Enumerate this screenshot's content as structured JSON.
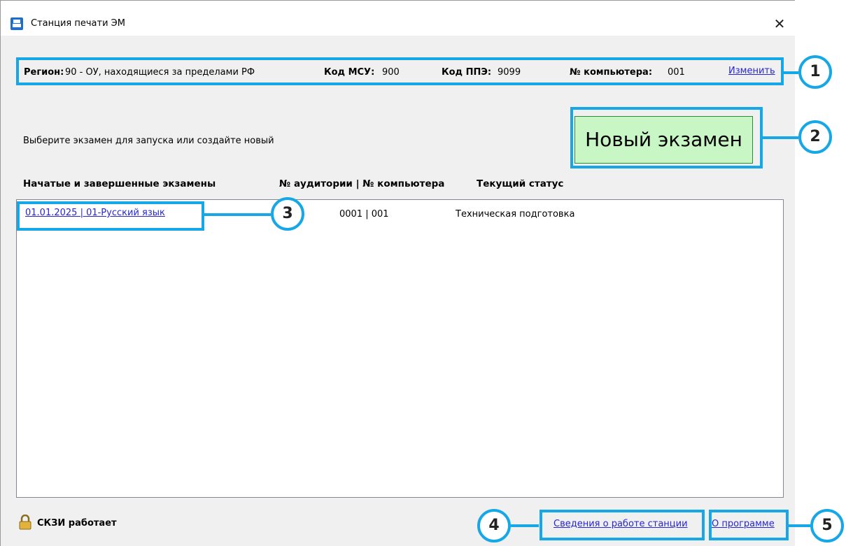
{
  "window": {
    "title": "Станция печати ЭМ",
    "close_glyph": "✕"
  },
  "info": {
    "region_label": "Регион:",
    "region_value": "90 - ОУ, находящиеся за пределами РФ",
    "msu_label": "Код МСУ:",
    "msu_value": "900",
    "ppe_label": "Код ППЭ:",
    "ppe_value": "9099",
    "computer_label": "№ компьютера:",
    "computer_value": "001",
    "change_link": "Изменить"
  },
  "prompt": "Выберите экзамен для запуска или создайте новый",
  "new_exam_button": "Новый экзамен",
  "list": {
    "headers": {
      "exams": "Начатые и завершенные экзамены",
      "room_computer": "№ аудитории | № компьютера",
      "status": "Текущий статус"
    },
    "rows": [
      {
        "exam": "01.01.2025 | 01-Русский язык",
        "room_computer": "0001 | 001",
        "status": "Техническая подготовка"
      }
    ]
  },
  "footer": {
    "crypto_status": "СКЗИ работает",
    "station_info_link": "Сведения о работе станции",
    "about_link": "О программе"
  },
  "callouts": [
    "1",
    "2",
    "3",
    "4",
    "5"
  ],
  "colors": {
    "highlight": "#16a7e6",
    "button_bg": "#c8f7c5",
    "link": "#2626d6"
  }
}
